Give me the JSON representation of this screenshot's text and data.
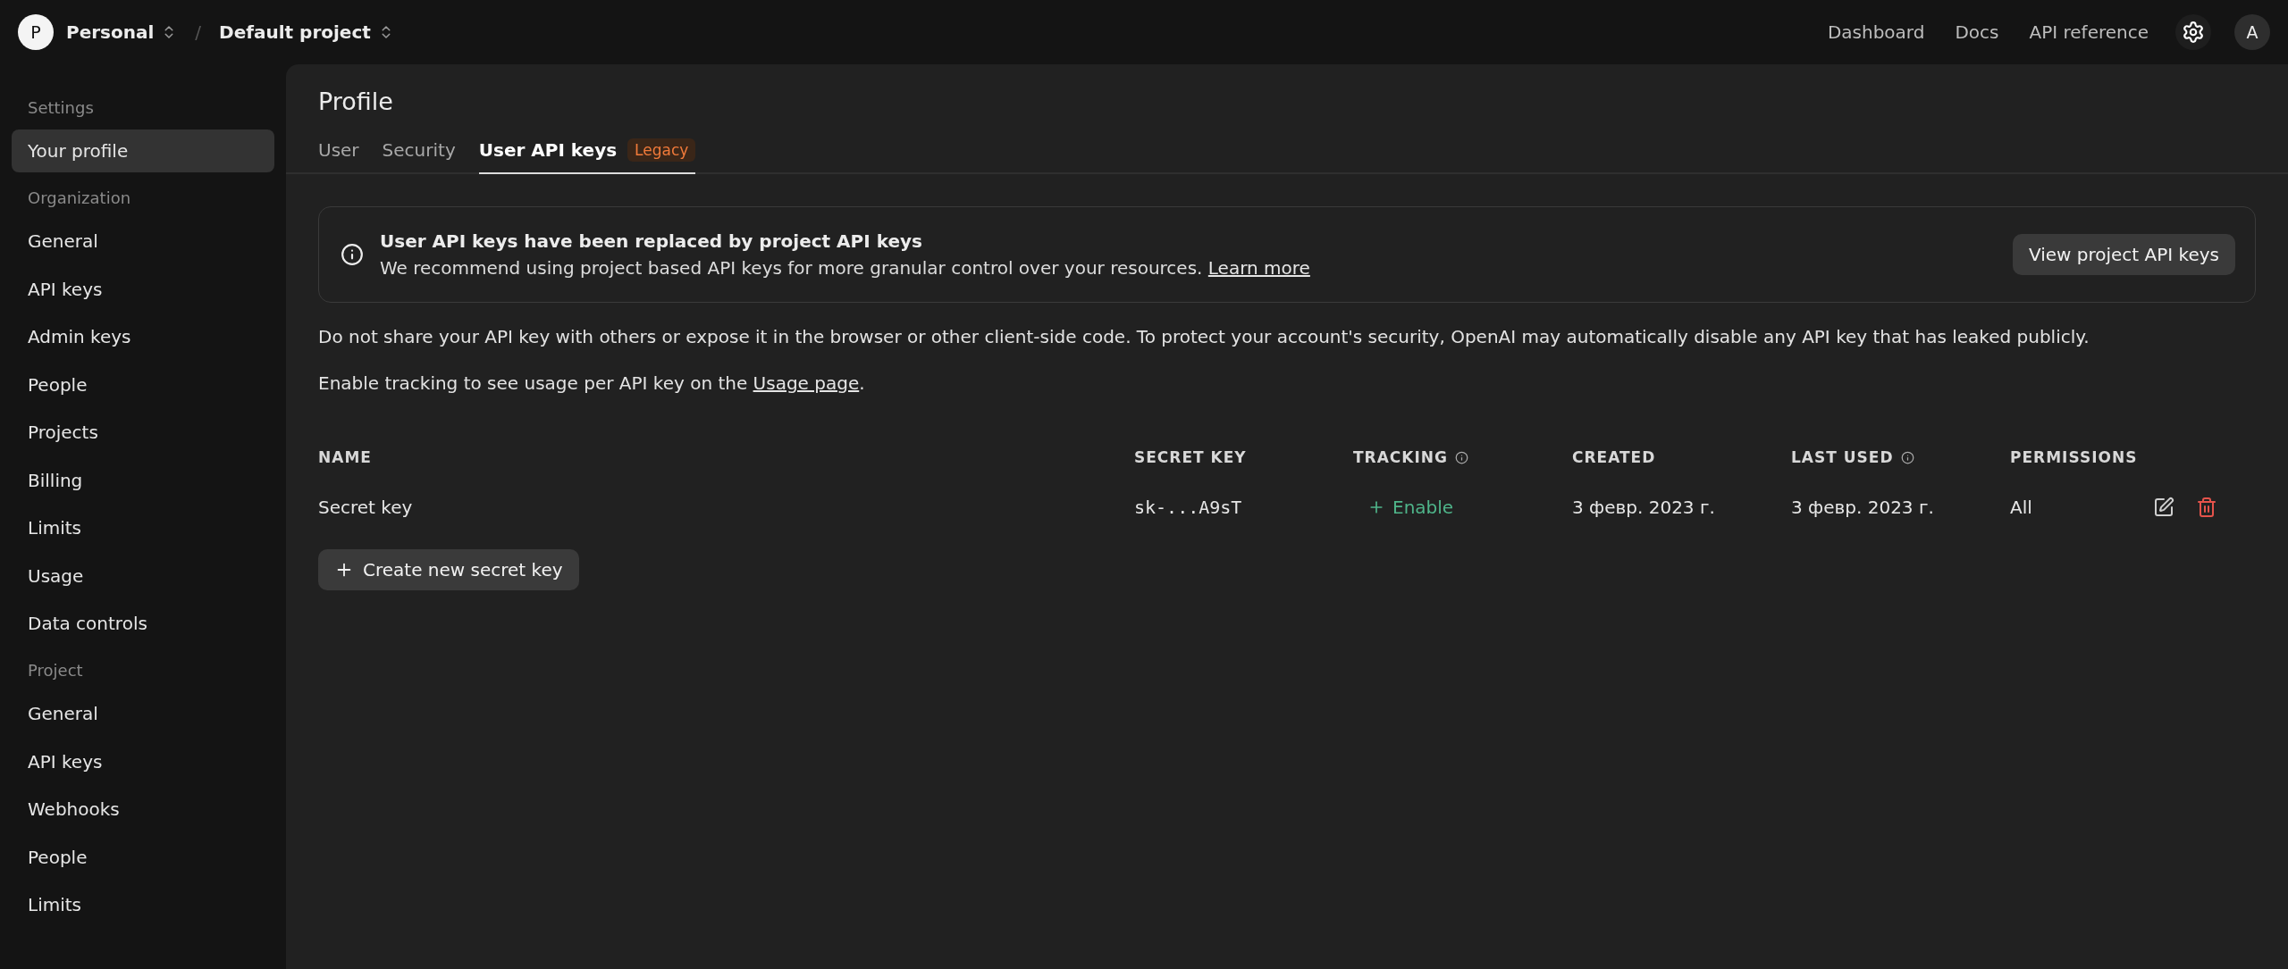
{
  "topbar": {
    "org": {
      "initial": "P",
      "name": "Personal"
    },
    "separator": "/",
    "project": "Default project",
    "links": [
      "Dashboard",
      "Docs",
      "API reference"
    ],
    "avatar": "A"
  },
  "sidebar": {
    "sections": [
      {
        "heading": "Settings",
        "items": [
          {
            "label": "Your profile",
            "selected": true
          }
        ]
      },
      {
        "heading": "Organization",
        "items": [
          {
            "label": "General",
            "selected": false
          },
          {
            "label": "API keys",
            "selected": false
          },
          {
            "label": "Admin keys",
            "selected": false
          },
          {
            "label": "People",
            "selected": false
          },
          {
            "label": "Projects",
            "selected": false
          },
          {
            "label": "Billing",
            "selected": false
          },
          {
            "label": "Limits",
            "selected": false
          },
          {
            "label": "Usage",
            "selected": false
          },
          {
            "label": "Data controls",
            "selected": false
          }
        ]
      },
      {
        "heading": "Project",
        "items": [
          {
            "label": "General",
            "selected": false
          },
          {
            "label": "API keys",
            "selected": false
          },
          {
            "label": "Webhooks",
            "selected": false
          },
          {
            "label": "People",
            "selected": false
          },
          {
            "label": "Limits",
            "selected": false
          }
        ]
      }
    ]
  },
  "page": {
    "title": "Profile",
    "tabs": [
      {
        "label": "User",
        "selected": false
      },
      {
        "label": "Security",
        "selected": false
      },
      {
        "label": "User API keys",
        "selected": true,
        "badge": "Legacy"
      }
    ],
    "notice": {
      "title": "User API keys have been replaced by project API keys",
      "text": "We recommend using project based API keys for more granular control over your resources.",
      "link": "Learn more",
      "button": "View project API keys"
    },
    "warning": "Do not share your API key with others or expose it in the browser or other client-side code. To protect your account's security, OpenAI may automatically disable any API key that has leaked publicly.",
    "tracking_note": {
      "before": "Enable tracking to see usage per API key on the",
      "link": "Usage page",
      "after": "."
    },
    "table": {
      "columns": [
        {
          "label": "NAME",
          "info": false
        },
        {
          "label": "SECRET KEY",
          "info": false
        },
        {
          "label": "TRACKING",
          "info": true
        },
        {
          "label": "CREATED",
          "info": false
        },
        {
          "label": "LAST USED",
          "info": true
        },
        {
          "label": "PERMISSIONS",
          "info": false
        }
      ],
      "rows": [
        {
          "name": "Secret key",
          "secret": "sk-...A9sT",
          "tracking": "Enable",
          "created": "3 февр. 2023 г.",
          "last_used": "3 февр. 2023 г.",
          "permissions": "All"
        }
      ]
    },
    "create_button": "Create new secret key"
  }
}
